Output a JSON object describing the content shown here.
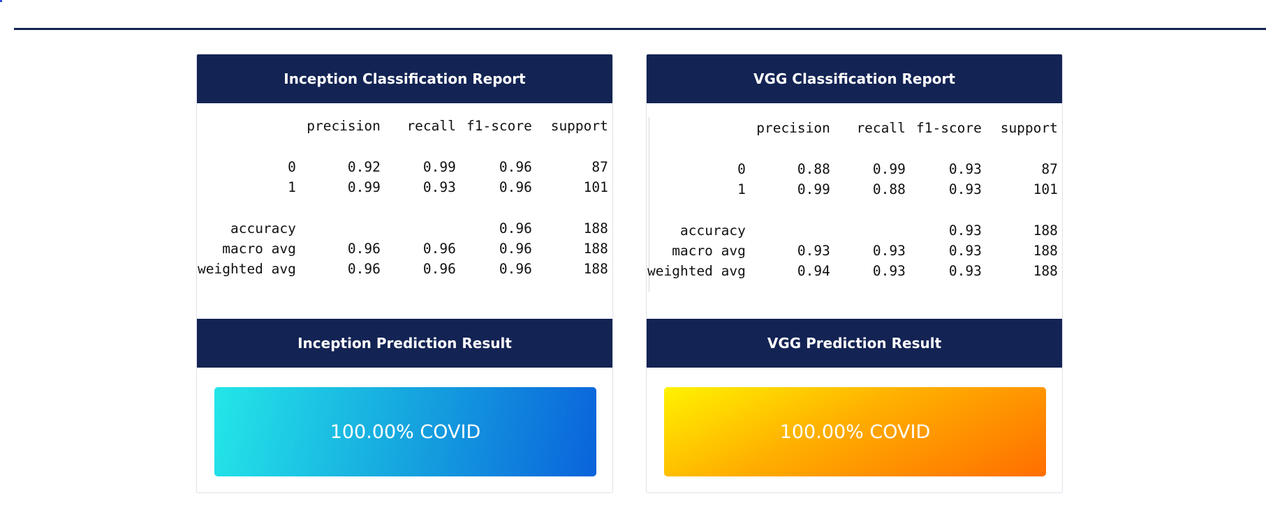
{
  "inception": {
    "report_title": "Inception Classification Report",
    "prediction_title": "Inception Prediction Result",
    "result_text": "100.00% COVID",
    "header_row": [
      "",
      "precision",
      "recall",
      "f1-score",
      "support"
    ],
    "rows": [
      [
        "0",
        "0.92",
        "0.99",
        "0.96",
        "87"
      ],
      [
        "1",
        "0.99",
        "0.93",
        "0.96",
        "101"
      ],
      [
        "accuracy",
        "",
        "",
        "0.96",
        "188"
      ],
      [
        "macro avg",
        "0.96",
        "0.96",
        "0.96",
        "188"
      ],
      [
        "weighted avg",
        "0.96",
        "0.96",
        "0.96",
        "188"
      ]
    ],
    "result_gradient": [
      "#24e6e8",
      "#0a63db"
    ]
  },
  "vgg": {
    "report_title": "VGG Classification Report",
    "prediction_title": "VGG Prediction Result",
    "result_text": "100.00% COVID",
    "header_row": [
      "",
      "precision",
      "recall",
      "f1-score",
      "support"
    ],
    "rows": [
      [
        "0",
        "0.88",
        "0.99",
        "0.93",
        "87"
      ],
      [
        "1",
        "0.99",
        "0.88",
        "0.93",
        "101"
      ],
      [
        "accuracy",
        "",
        "",
        "0.93",
        "188"
      ],
      [
        "macro avg",
        "0.93",
        "0.93",
        "0.93",
        "188"
      ],
      [
        "weighted avg",
        "0.94",
        "0.93",
        "0.93",
        "188"
      ]
    ],
    "result_gradient": [
      "#fff200",
      "#ff6e00"
    ]
  },
  "theme": {
    "header_bg": "#132353",
    "header_text": "#ffffff"
  }
}
